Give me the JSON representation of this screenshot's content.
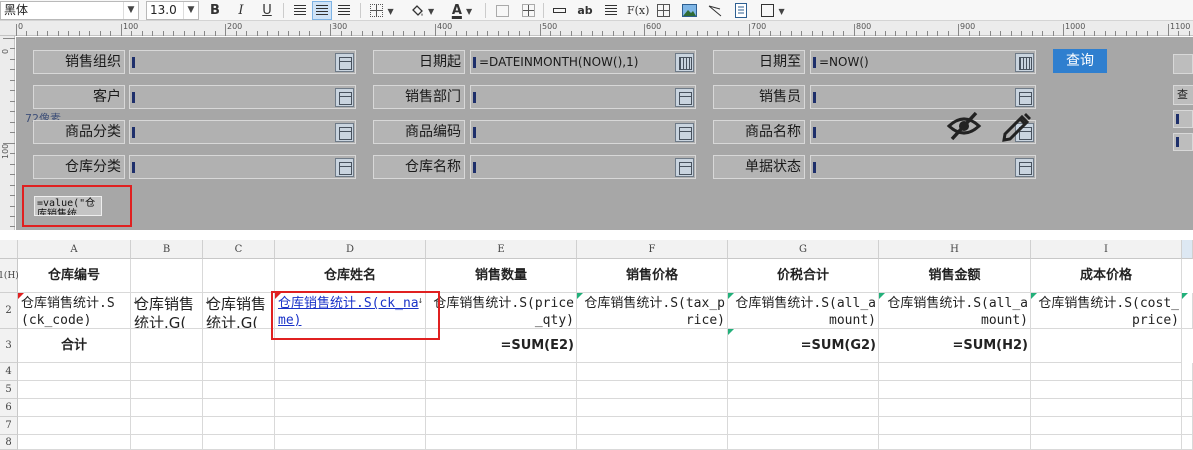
{
  "toolbar": {
    "font_name": "黑体",
    "font_size": "13.0",
    "bold": "B",
    "italic": "I",
    "underline": "U",
    "text_tool": "ab",
    "func_tool": "F(x)"
  },
  "ruler": {
    "top_marks": [
      "0",
      "100",
      "200",
      "300",
      "400",
      "500",
      "600",
      "700",
      "800",
      "900",
      "1000",
      "1100"
    ],
    "left_marks": [
      "0",
      "100"
    ]
  },
  "params": {
    "sales_org_label": "销售组织",
    "date_from_label": "日期起",
    "date_from_value": "=DATEINMONTH(NOW(),1)",
    "date_to_label": "日期至",
    "date_to_value": "=NOW()",
    "query_label": "查询",
    "customer_label": "客户",
    "sales_dept_label": "销售部门",
    "salesperson_label": "销售员",
    "product_cat_label": "商品分类",
    "product_code_label": "商品编码",
    "product_name_label": "商品名称",
    "warehouse_cat_label": "仓库分类",
    "warehouse_name_label": "仓库名称",
    "doc_status_label": "单据状态",
    "px_label": "72像素",
    "formula_text": "=value(\"仓库销售统计\",",
    "side_glyph": "查"
  },
  "sheet": {
    "columns": [
      "A",
      "B",
      "C",
      "D",
      "E",
      "F",
      "G",
      "H",
      "I"
    ],
    "rows": [
      "1(H)",
      "2",
      "3",
      "4",
      "5",
      "6",
      "7",
      "8"
    ],
    "header": {
      "A": "仓库编号",
      "B": "",
      "C": "",
      "D": "仓库姓名",
      "E": "销售数量",
      "F": "销售价格",
      "G": "价税合计",
      "H": "销售金额",
      "I": "成本价格"
    },
    "row2": {
      "A": "仓库销售统计.S(ck_code)",
      "B": "仓库销售统计.G(",
      "C": "仓库销售统计.G(",
      "D": "仓库销售统计.S(ck_name)",
      "E": "仓库销售统计.S(price_qty)",
      "F": "仓库销售统计.S(tax_price)",
      "G": "仓库销售统计.S(all_amount)",
      "H": "仓库销售统计.S(all_amount)",
      "I": "仓库销售统计.S(cost_price)"
    },
    "row3": {
      "A": "合计",
      "E": "=SUM(E2)",
      "G": "=SUM(G2)",
      "H": "=SUM(H2)"
    }
  },
  "colors": {
    "accent_blue": "#2f7fcf",
    "highlight_red": "#e02020",
    "panel_gray": "#a7a7a7"
  },
  "icons": [
    "hide-icon",
    "edit-icon",
    "calendar-icon",
    "picker-icon"
  ]
}
